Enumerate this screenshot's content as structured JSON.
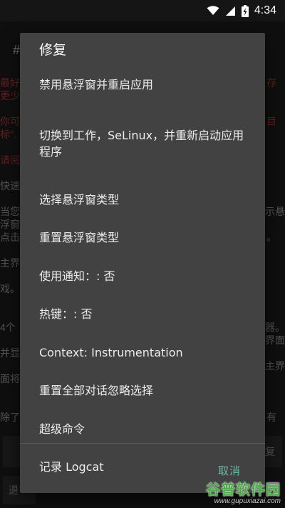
{
  "status_bar": {
    "time": "4:34",
    "icons": [
      "wifi-icon",
      "cellular-signal-icon",
      "battery-charging-icon"
    ]
  },
  "background": {
    "fragments": [
      "#",
      "最好",
      "更少",
      "你可",
      "标\".",
      "请阅",
      "快速",
      "当您",
      "浮窗",
      "点击",
      "主界",
      "戏。",
      "4个",
      "并显",
      "面将",
      "除了",
      "有",
      "存",
      "示悬",
      "。",
      "器。",
      "界面",
      "主界",
      "目",
      "复",
      "退"
    ]
  },
  "dialog": {
    "title": "修复",
    "items": [
      "禁用悬浮窗并重启应用",
      "切换到工作，SeLinux，并重新启动应用程序",
      "选择悬浮窗类型",
      "重置悬浮窗类型",
      "使用通知：: 否",
      "热键：: 否",
      "Context: Instrumentation",
      "重置全部对话忽略选择",
      "超级命令",
      "记录 Logcat"
    ],
    "cancel_label": "取消"
  },
  "watermark": {
    "logo": "谷普软件园",
    "url": "www.gupuxiazai.com"
  },
  "colors": {
    "dialog_bg": "#424242",
    "accent": "#6fb7a6",
    "background": "#1c1c1c"
  }
}
